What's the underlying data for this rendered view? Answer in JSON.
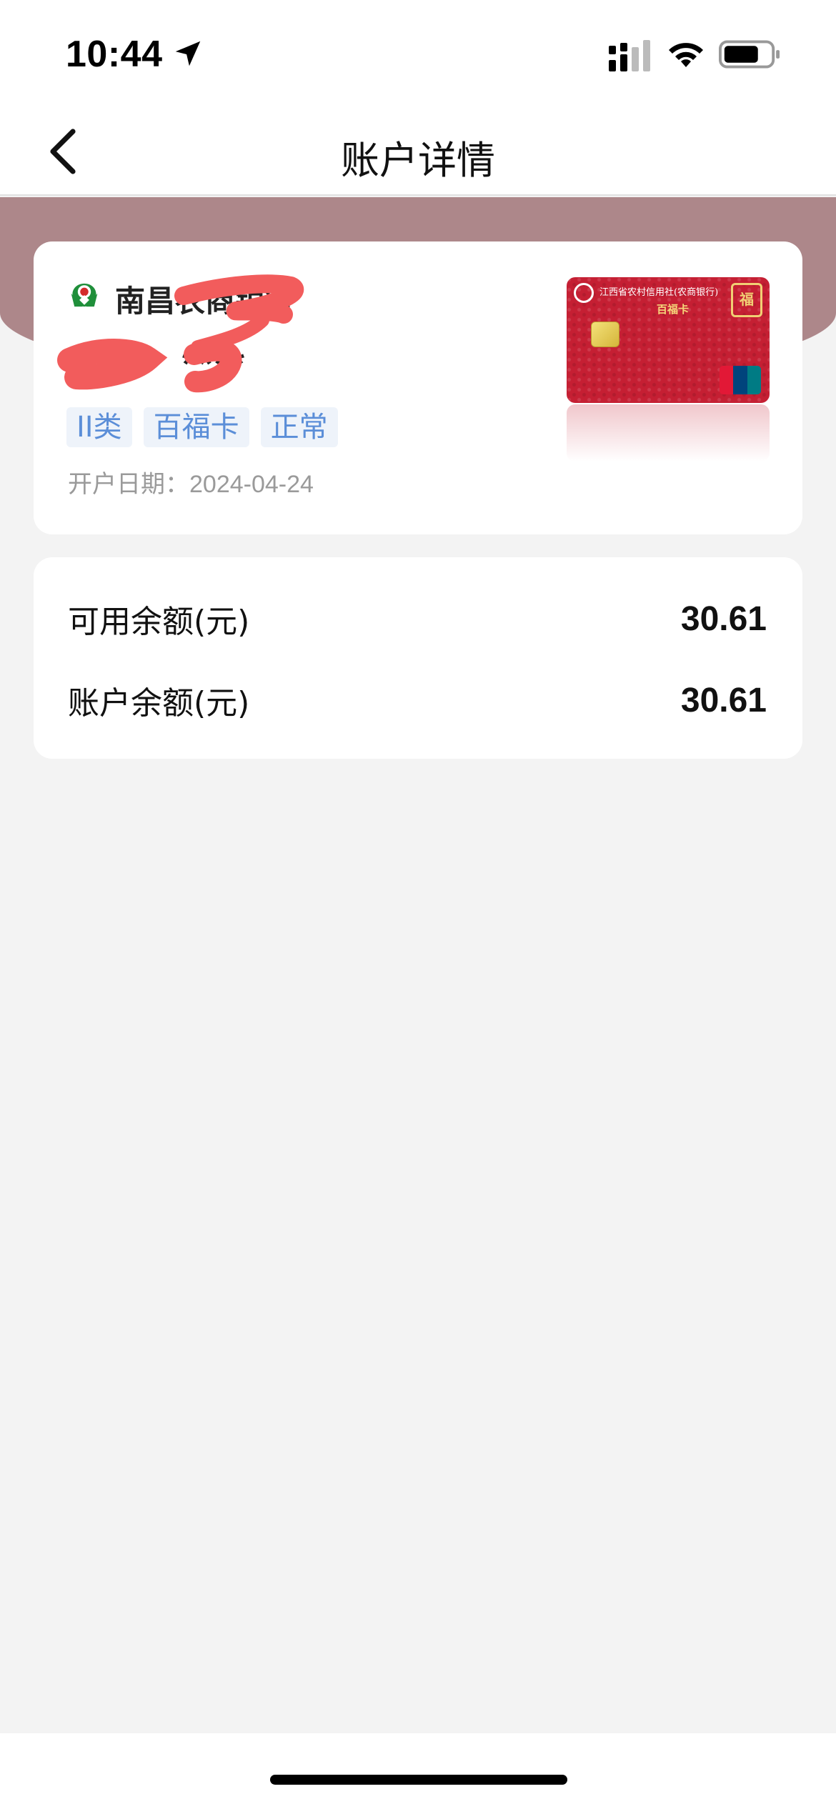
{
  "status_bar": {
    "time": "10:44"
  },
  "nav": {
    "title": "账户详情"
  },
  "account": {
    "bank_name": "南昌农商银行",
    "card_number_masked": "****",
    "tags": [
      "II类",
      "百福卡",
      "正常"
    ],
    "open_date_label": "开户日期：",
    "open_date": "2024-04-24"
  },
  "card_image": {
    "issuer_text": "江西省农村信用社(农商银行)",
    "product_text": "百福卡"
  },
  "balances": {
    "available_label": "可用余额(元)",
    "available_value": "30.61",
    "account_label": "账户余额(元)",
    "account_value": "30.61"
  },
  "colors": {
    "header_band": "#ad878a",
    "tag_text": "#5b8ed8",
    "tag_bg": "#eef3fa",
    "card_red": "#c51f33",
    "redaction": "#f25c5c"
  }
}
